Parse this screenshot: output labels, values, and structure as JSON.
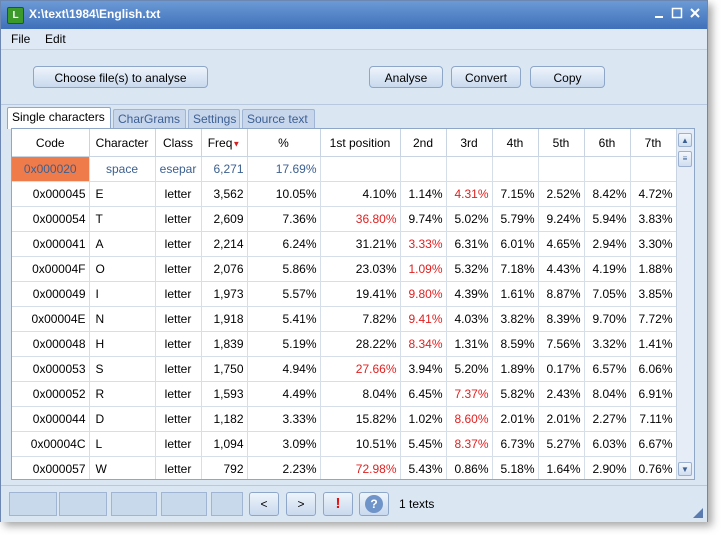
{
  "window": {
    "title": "X:\\text\\1984\\English.txt",
    "app_icon": "L"
  },
  "menu": [
    {
      "label": "File"
    },
    {
      "label": "Edit"
    }
  ],
  "toolbar": {
    "choose_label": "Choose file(s) to analyse",
    "analyse_label": "Analyse",
    "convert_label": "Convert",
    "copy_label": "Copy"
  },
  "tabs": [
    {
      "label": "Single characters",
      "active": true
    },
    {
      "label": "CharGrams"
    },
    {
      "label": "Settings"
    },
    {
      "label": "Source text"
    }
  ],
  "grid": {
    "headers": [
      "Code",
      "Character",
      "Class",
      "Freq",
      "%",
      "1st position",
      "2nd",
      "3rd",
      "4th",
      "5th",
      "6th",
      "7th"
    ],
    "sort_indicator": "▼",
    "rows": [
      {
        "code": "0x000020",
        "char": "space",
        "class": "esepar",
        "freq": "6,271",
        "pct": "17.69%",
        "p1": "",
        "p2": "",
        "p3": "",
        "p4": "",
        "p5": "",
        "p6": "",
        "p7": ""
      },
      {
        "code": "0x000045",
        "char": "E",
        "class": "letter",
        "freq": "3,562",
        "pct": "10.05%",
        "p1": "4.10%",
        "p2": "1.14%",
        "p3": "4.31%",
        "p4": "7.15%",
        "p5": "2.52%",
        "p6": "8.42%",
        "p7": "4.72%"
      },
      {
        "code": "0x000054",
        "char": "T",
        "class": "letter",
        "freq": "2,609",
        "pct": "7.36%",
        "p1": "36.80%",
        "p2": "9.74%",
        "p3": "5.02%",
        "p4": "5.79%",
        "p5": "9.24%",
        "p6": "5.94%",
        "p7": "3.83%"
      },
      {
        "code": "0x000041",
        "char": "A",
        "class": "letter",
        "freq": "2,214",
        "pct": "6.24%",
        "p1": "31.21%",
        "p2": "3.33%",
        "p3": "6.31%",
        "p4": "6.01%",
        "p5": "4.65%",
        "p6": "2.94%",
        "p7": "3.30%"
      },
      {
        "code": "0x00004F",
        "char": "O",
        "class": "letter",
        "freq": "2,076",
        "pct": "5.86%",
        "p1": "23.03%",
        "p2": "1.09%",
        "p3": "5.32%",
        "p4": "7.18%",
        "p5": "4.43%",
        "p6": "4.19%",
        "p7": "1.88%"
      },
      {
        "code": "0x000049",
        "char": "I",
        "class": "letter",
        "freq": "1,973",
        "pct": "5.57%",
        "p1": "19.41%",
        "p2": "9.80%",
        "p3": "4.39%",
        "p4": "1.61%",
        "p5": "8.87%",
        "p6": "7.05%",
        "p7": "3.85%"
      },
      {
        "code": "0x00004E",
        "char": "N",
        "class": "letter",
        "freq": "1,918",
        "pct": "5.41%",
        "p1": "7.82%",
        "p2": "9.41%",
        "p3": "4.03%",
        "p4": "3.82%",
        "p5": "8.39%",
        "p6": "9.70%",
        "p7": "7.72%"
      },
      {
        "code": "0x000048",
        "char": "H",
        "class": "letter",
        "freq": "1,839",
        "pct": "5.19%",
        "p1": "28.22%",
        "p2": "8.34%",
        "p3": "1.31%",
        "p4": "8.59%",
        "p5": "7.56%",
        "p6": "3.32%",
        "p7": "1.41%"
      },
      {
        "code": "0x000053",
        "char": "S",
        "class": "letter",
        "freq": "1,750",
        "pct": "4.94%",
        "p1": "27.66%",
        "p2": "3.94%",
        "p3": "5.20%",
        "p4": "1.89%",
        "p5": "0.17%",
        "p6": "6.57%",
        "p7": "6.06%"
      },
      {
        "code": "0x000052",
        "char": "R",
        "class": "letter",
        "freq": "1,593",
        "pct": "4.49%",
        "p1": "8.04%",
        "p2": "6.45%",
        "p3": "7.37%",
        "p4": "5.82%",
        "p5": "2.43%",
        "p6": "8.04%",
        "p7": "6.91%"
      },
      {
        "code": "0x000044",
        "char": "D",
        "class": "letter",
        "freq": "1,182",
        "pct": "3.33%",
        "p1": "15.82%",
        "p2": "1.02%",
        "p3": "8.60%",
        "p4": "2.01%",
        "p5": "2.01%",
        "p6": "2.27%",
        "p7": "7.11%"
      },
      {
        "code": "0x00004C",
        "char": "L",
        "class": "letter",
        "freq": "1,094",
        "pct": "3.09%",
        "p1": "10.51%",
        "p2": "5.45%",
        "p3": "8.37%",
        "p4": "6.73%",
        "p5": "5.27%",
        "p6": "6.03%",
        "p7": "6.67%"
      },
      {
        "code": "0x000057",
        "char": "W",
        "class": "letter",
        "freq": "792",
        "pct": "2.23%",
        "p1": "72.98%",
        "p2": "5.43%",
        "p3": "0.86%",
        "p4": "5.18%",
        "p5": "1.64%",
        "p6": "2.90%",
        "p7": "0.76%"
      }
    ],
    "red_cells": [
      "2.p1",
      "3.p2",
      "4.p2",
      "5.p2",
      "6.p2",
      "7.p2",
      "8.p1",
      "9.p3",
      "10.p3",
      "11.p3",
      "12.p1",
      "1.p3"
    ]
  },
  "status": {
    "prev_label": "<",
    "next_label": ">",
    "alert_glyph": "!",
    "help_glyph": "?",
    "text": "1 texts"
  },
  "colors": {
    "accent": "#3f70b9",
    "selected_cell": "#f07b4a",
    "red_value": "#e02020"
  },
  "icons": [
    "minimize-icon",
    "maximize-icon",
    "close-icon",
    "sort-desc-icon",
    "scroll-up-icon",
    "scroll-down-icon",
    "alert-icon",
    "help-icon",
    "resize-grip-icon"
  ]
}
